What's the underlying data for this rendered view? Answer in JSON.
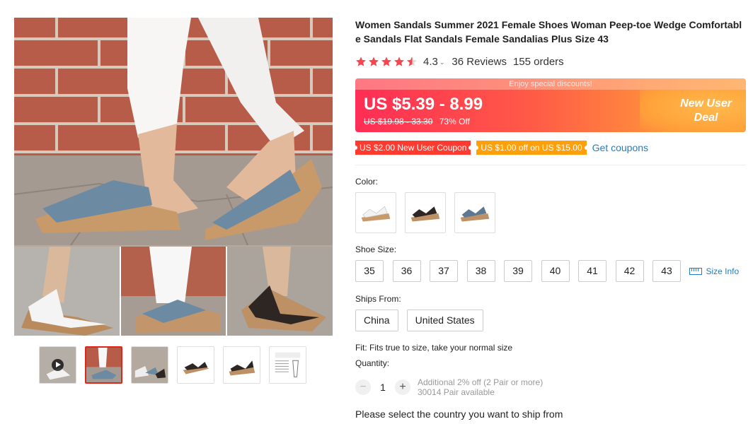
{
  "product": {
    "title": "Women Sandals Summer 2021 Female Shoes Woman Peep-toe Wedge Comfortable Sandals Flat Sandals Female Sandalias Plus Size 43",
    "rating": "4.3",
    "rating_stars": 4.3,
    "reviews": "36 Reviews",
    "orders": "155 orders"
  },
  "price": {
    "banner_text": "Enjoy special discounts!",
    "current": "US $5.39 - 8.99",
    "original": "US $19.98 - 33.30",
    "discount": "73% Off",
    "deal_line1": "New User",
    "deal_line2": "Deal"
  },
  "coupons": {
    "new_user": "US $2.00 New User Coupon",
    "store": "US $1.00 off on US $15.00",
    "get": "Get coupons"
  },
  "color": {
    "label": "Color:",
    "options": [
      "white",
      "black",
      "blue"
    ]
  },
  "size": {
    "label": "Shoe Size:",
    "options": [
      "35",
      "36",
      "37",
      "38",
      "39",
      "40",
      "41",
      "42",
      "43"
    ],
    "info": "Size Info"
  },
  "ships": {
    "label": "Ships From:",
    "options": [
      "China",
      "United States"
    ]
  },
  "fit": "Fit: Fits true to size, take your normal size",
  "quantity": {
    "label": "Quantity:",
    "minus": "−",
    "value": "1",
    "plus": "+",
    "note1": "Additional 2% off (2 Pair or more)",
    "note2": "30014 Pair available"
  },
  "ship_prompt": "Please select the country you want to ship from",
  "colors": {
    "price_red": "#ff2d55",
    "price_orange": "#ffa23a",
    "coupon_red": "#ff3b30",
    "coupon_orange": "#ff9f0a",
    "link_blue": "#1f7fc1",
    "star": "#f5474f",
    "active_thumb": "#e0261c"
  },
  "icons": [
    "star-icon",
    "chevron-down-icon",
    "play-icon",
    "ruler-icon"
  ]
}
